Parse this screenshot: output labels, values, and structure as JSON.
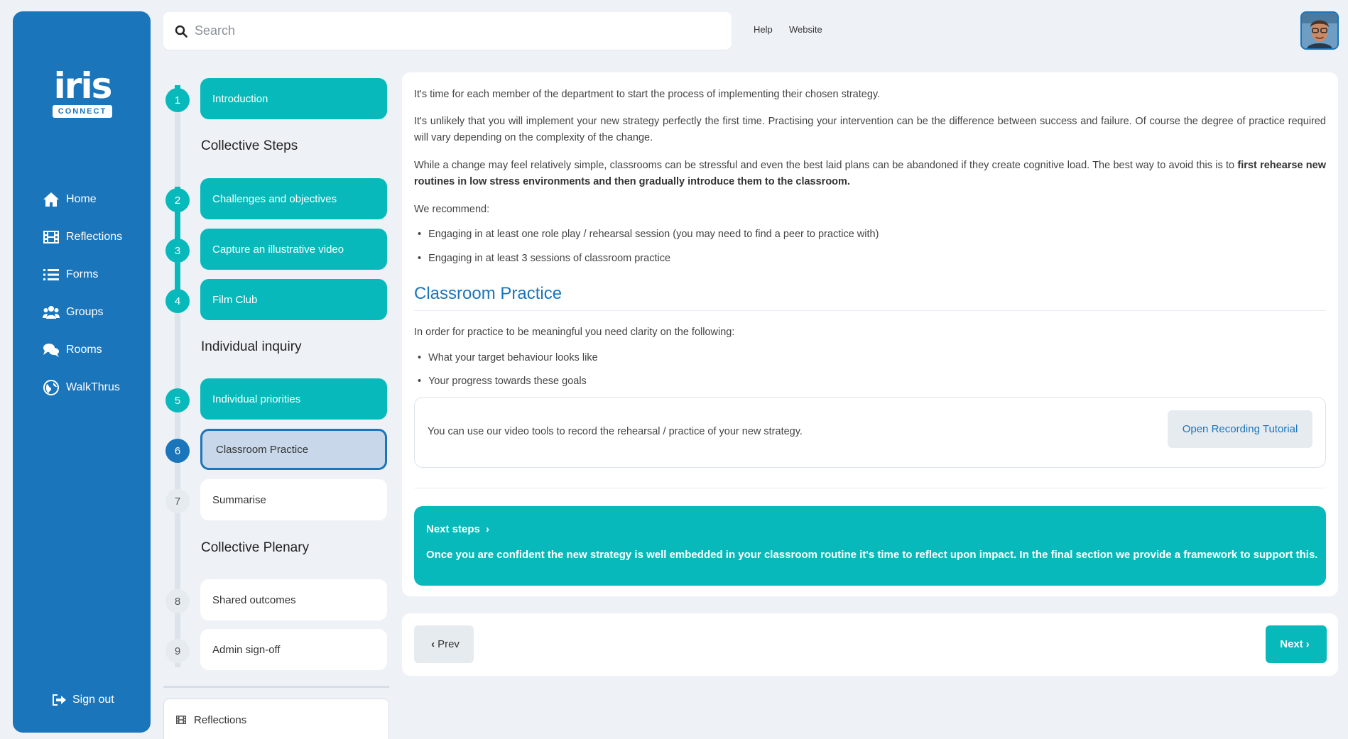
{
  "brand": {
    "name": "iris",
    "sub": "CONNECT"
  },
  "sidebar": {
    "items": [
      {
        "label": "Home",
        "icon": "home-icon"
      },
      {
        "label": "Reflections",
        "icon": "film-icon"
      },
      {
        "label": "Forms",
        "icon": "list-icon"
      },
      {
        "label": "Groups",
        "icon": "users-icon"
      },
      {
        "label": "Rooms",
        "icon": "chat-icon"
      },
      {
        "label": "WalkThrus",
        "icon": "globe-icon"
      }
    ],
    "signout": "Sign out"
  },
  "search": {
    "placeholder": "Search"
  },
  "toplinks": {
    "help": "Help",
    "website": "Website"
  },
  "steps": {
    "sections": {
      "collective": "Collective Steps",
      "individual": "Individual inquiry",
      "plenary": "Collective Plenary"
    },
    "items": [
      {
        "num": "1",
        "label": "Introduction",
        "state": "done"
      },
      {
        "num": "2",
        "label": "Challenges and objectives",
        "state": "done"
      },
      {
        "num": "3",
        "label": "Capture an illustrative video",
        "state": "done"
      },
      {
        "num": "4",
        "label": "Film Club",
        "state": "done"
      },
      {
        "num": "5",
        "label": "Individual priorities",
        "state": "done"
      },
      {
        "num": "6",
        "label": "Classroom Practice",
        "state": "current"
      },
      {
        "num": "7",
        "label": "Summarise",
        "state": "todo"
      },
      {
        "num": "8",
        "label": "Shared outcomes",
        "state": "todo"
      },
      {
        "num": "9",
        "label": "Admin sign-off",
        "state": "todo"
      }
    ],
    "reflections_tab": "Reflections"
  },
  "content": {
    "p1": "It's time for each member of the department to start the process of implementing their chosen strategy.",
    "p2": "It's unlikely that you will implement your new strategy perfectly the first time. Practising your intervention can be the difference between success and failure. Of course the degree of practice required will vary depending on the complexity of the change.",
    "p3_start": "While a change may feel relatively simple, classrooms can be stressful and even the best laid plans can be abandoned if they create cognitive load. The best way to avoid this is to ",
    "p3_bold": "first rehearse new routines in low stress environments and then gradually introduce them to the classroom.",
    "recommend": "We recommend:",
    "rec_bullets": [
      "Engaging in at least one role play / rehearsal session (you may need to find a peer to practice with)",
      "Engaging in at least 3 sessions of classroom practice"
    ],
    "heading": "Classroom Practice",
    "clarity": "In order for practice to be meaningful you need clarity on the following:",
    "clarity_bullets": [
      "What your target behaviour looks like",
      "Your progress towards these goals"
    ],
    "tutorial_text": "You can use our video tools to record the rehearsal / practice of your new strategy.",
    "tutorial_button": "Open Recording Tutorial",
    "next_title": "Next steps",
    "next_body": "Once you are confident the new strategy is well embedded in your classroom routine it's time to reflect upon impact. In the final section we provide a framework to support this."
  },
  "pager": {
    "prev": "Prev",
    "next": "Next"
  },
  "colors": {
    "brand_blue": "#1b75bb",
    "teal": "#08b9bc",
    "bg": "#eef2f7"
  }
}
